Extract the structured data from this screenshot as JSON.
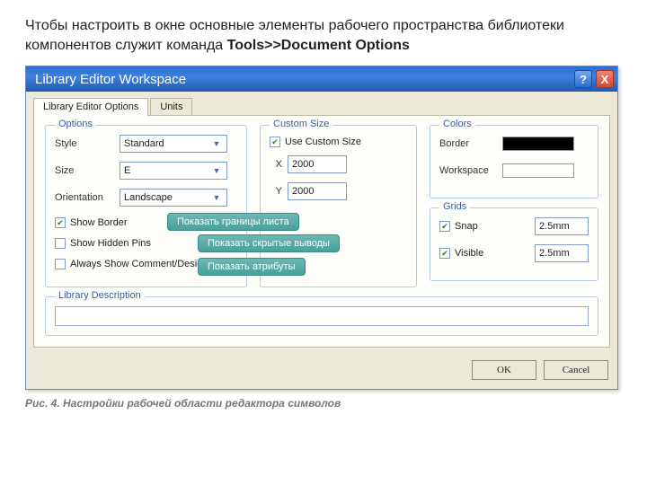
{
  "intro": {
    "text_before": "Чтобы настроить в окне основные элементы рабочего пространства библиотеки компонентов служит команда ",
    "command": "Tools>>Document Options"
  },
  "window": {
    "title": "Library Editor Workspace",
    "help": "?",
    "close": "X"
  },
  "tabs": {
    "t1": "Library Editor Options",
    "t2": "Units"
  },
  "options": {
    "group": "Options",
    "style_label": "Style",
    "style_value": "Standard",
    "size_label": "Size",
    "size_value": "E",
    "orient_label": "Orientation",
    "orient_value": "Landscape",
    "show_border": "Show Border",
    "show_hidden": "Show Hidden Pins",
    "always_show": "Always Show Comment/Designator"
  },
  "custom": {
    "group": "Custom Size",
    "use": "Use Custom Size",
    "x_label": "X",
    "x_value": "2000",
    "y_label": "Y",
    "y_value": "2000"
  },
  "colors": {
    "group": "Colors",
    "border_label": "Border",
    "border_color": "#000000",
    "workspace_label": "Workspace",
    "workspace_color": "#fdfdf9"
  },
  "grids": {
    "group": "Grids",
    "snap_label": "Snap",
    "snap_value": "2.5mm",
    "visible_label": "Visible",
    "visible_value": "2.5mm"
  },
  "desc": {
    "group": "Library Description"
  },
  "callouts": {
    "c1": "Показать границы листа",
    "c2": "Показать скрытые выводы",
    "c3": "Показать атрибуты"
  },
  "buttons": {
    "ok": "OK",
    "cancel": "Cancel"
  },
  "caption": "Рис. 4. Настройки рабочей области редактора символов"
}
